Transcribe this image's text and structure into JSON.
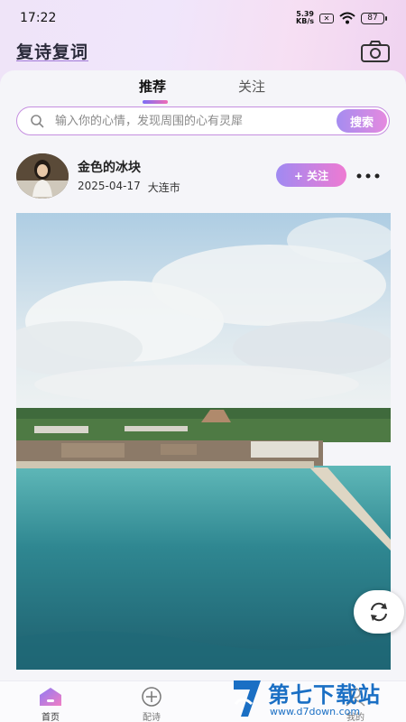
{
  "status": {
    "time": "17:22",
    "net_speed_top": "5.39",
    "net_speed_bottom": "KB/s",
    "battery": "87"
  },
  "app": {
    "title": "复诗复词"
  },
  "tabs": [
    {
      "label": "推荐"
    },
    {
      "label": "关注"
    }
  ],
  "search": {
    "placeholder": "输入你的心情，发现周围的心有灵犀",
    "button_label": "搜索"
  },
  "post": {
    "author": "金色的冰块",
    "date": "2025-04-17",
    "location": "大连市",
    "follow_label": "+ 关注"
  },
  "bottom_nav": [
    {
      "label": "首页",
      "icon": "home-icon"
    },
    {
      "label": "配诗",
      "icon": "plus-circle-icon"
    },
    {
      "label": "我的",
      "icon": "profile-icon"
    }
  ],
  "watermark": {
    "title": "第七下载站",
    "url": "www.d7down.com"
  },
  "colors": {
    "accent_start": "#7b6cf5",
    "accent_end": "#f06bb6",
    "background": "#f5f5f9"
  }
}
